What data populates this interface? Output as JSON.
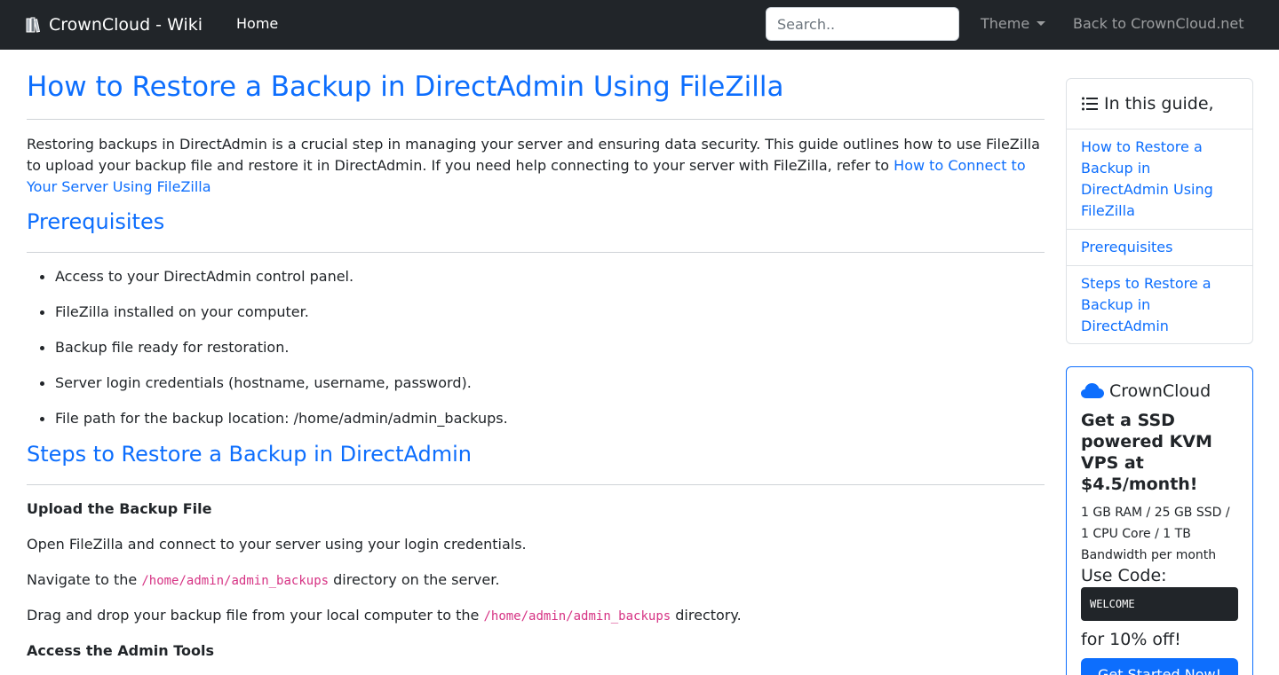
{
  "navbar": {
    "brand": "CrownCloud - Wiki",
    "brand_icon": "books-icon",
    "home_label": "Home",
    "search_placeholder": "Search..",
    "theme_label": "Theme",
    "back_label": "Back to CrownCloud.net"
  },
  "article": {
    "title": "How to Restore a Backup in DirectAdmin Using FileZilla",
    "intro_text": "Restoring backups in DirectAdmin is a crucial step in managing your server and ensuring data security. This guide outlines how to use FileZilla to upload your backup file and restore it in DirectAdmin. If you need help connecting to your server with FileZilla, refer to ",
    "intro_link": "How to Connect to Your Server Using FileZilla",
    "prereq_heading": "Prerequisites",
    "prereq_items": [
      "Access to your DirectAdmin control panel.",
      "FileZilla installed on your computer.",
      "Backup file ready for restoration.",
      "Server login credentials (hostname, username, password).",
      "File path for the backup location: /home/admin/admin_backups."
    ],
    "steps_heading": "Steps to Restore a Backup in DirectAdmin",
    "upload_heading": "Upload the Backup File",
    "step_open": "Open FileZilla and connect to your server using your login credentials.",
    "step_navigate_before": "Navigate to the ",
    "step_navigate_code": "/home/admin/admin_backups",
    "step_navigate_after": " directory on the server.",
    "step_drag_before": "Drag and drop your backup file from your local computer to the ",
    "step_drag_code": "/home/admin/admin_backups",
    "step_drag_after": " directory.",
    "admin_tools_heading": "Access the Admin Tools"
  },
  "toc": {
    "title": "In this guide,",
    "items": [
      "How to Restore a Backup in DirectAdmin Using FileZilla",
      "Prerequisites",
      "Steps to Restore a Backup in DirectAdmin"
    ]
  },
  "promo": {
    "brand": "CrownCloud",
    "headline": "Get a SSD powered KVM VPS at $4.5/month!",
    "spec": "1 GB RAM / 25 GB SSD / 1 CPU Core / 1 TB Bandwidth per month",
    "code_label": "Use Code:",
    "code": "WELCOME",
    "discount": "for 10% off!",
    "cta": "Get Started Now!"
  },
  "colors": {
    "navbar_bg": "#212529",
    "link": "#0d6efd",
    "code": "#d63384"
  }
}
